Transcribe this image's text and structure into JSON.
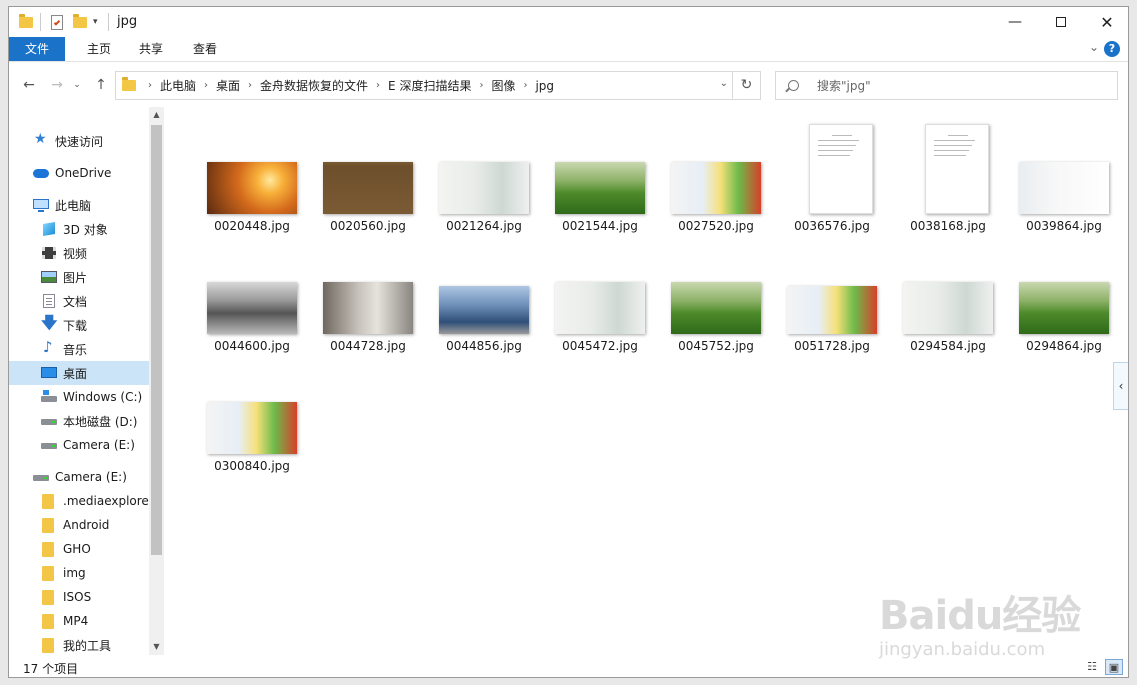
{
  "window": {
    "title": "jpg"
  },
  "ribbon": {
    "tabs": [
      "文件",
      "主页",
      "共享",
      "查看"
    ]
  },
  "nav": {
    "breadcrumbs": [
      "此电脑",
      "桌面",
      "金舟数据恢复的文件",
      "E 深度扫描结果",
      "图像",
      "jpg"
    ],
    "search_placeholder": "搜索\"jpg\""
  },
  "sidebar": {
    "items": [
      {
        "label": "快速访问",
        "icon": "star-icon"
      },
      {
        "label": "OneDrive",
        "icon": "cloud-icon"
      },
      {
        "label": "此电脑",
        "icon": "computer-icon"
      },
      {
        "label": "3D 对象",
        "icon": "cube-icon"
      },
      {
        "label": "视频",
        "icon": "video-icon"
      },
      {
        "label": "图片",
        "icon": "picture-icon"
      },
      {
        "label": "文档",
        "icon": "document-icon"
      },
      {
        "label": "下载",
        "icon": "download-icon"
      },
      {
        "label": "音乐",
        "icon": "music-icon"
      },
      {
        "label": "桌面",
        "icon": "desktop-icon",
        "selected": true
      },
      {
        "label": "Windows (C:)",
        "icon": "drive-c-icon"
      },
      {
        "label": "本地磁盘 (D:)",
        "icon": "drive-icon"
      },
      {
        "label": "Camera (E:)",
        "icon": "drive-icon"
      },
      {
        "label": "Camera (E:)",
        "icon": "drive-icon"
      },
      {
        "label": ".mediaexplorer",
        "icon": "folder-icon"
      },
      {
        "label": "Android",
        "icon": "folder-icon"
      },
      {
        "label": "GHO",
        "icon": "folder-icon"
      },
      {
        "label": "img",
        "icon": "folder-icon"
      },
      {
        "label": "ISOS",
        "icon": "folder-icon"
      },
      {
        "label": "MP4",
        "icon": "folder-icon"
      },
      {
        "label": "我的工具",
        "icon": "folder-icon"
      }
    ]
  },
  "files": [
    {
      "name": "0020448.jpg",
      "kind": "sunset"
    },
    {
      "name": "0020560.jpg",
      "kind": "brown"
    },
    {
      "name": "0021264.jpg",
      "kind": "stretch"
    },
    {
      "name": "0021544.jpg",
      "kind": "grass"
    },
    {
      "name": "0027520.jpg",
      "kind": "veggies"
    },
    {
      "name": "0036576.jpg",
      "kind": "doc"
    },
    {
      "name": "0038168.jpg",
      "kind": "doc"
    },
    {
      "name": "0039864.jpg",
      "kind": "sleep"
    },
    {
      "name": "0044600.jpg",
      "kind": "office"
    },
    {
      "name": "0044728.jpg",
      "kind": "lobby"
    },
    {
      "name": "0044856.jpg",
      "kind": "building"
    },
    {
      "name": "0045472.jpg",
      "kind": "stretch"
    },
    {
      "name": "0045752.jpg",
      "kind": "grass"
    },
    {
      "name": "0051728.jpg",
      "kind": "veggies"
    },
    {
      "name": "0294584.jpg",
      "kind": "stretch"
    },
    {
      "name": "0294864.jpg",
      "kind": "grass"
    },
    {
      "name": "0300840.jpg",
      "kind": "veggies"
    }
  ],
  "status": {
    "count": "17 个项目"
  },
  "watermark": {
    "logo": "Baidu经验",
    "url": "jingyan.baidu.com"
  }
}
